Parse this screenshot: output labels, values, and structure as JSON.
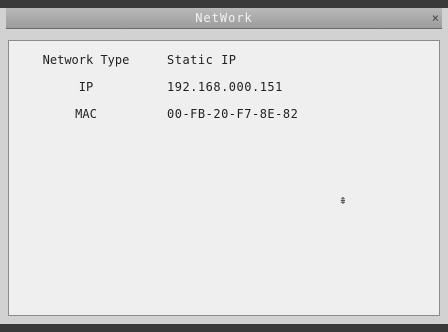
{
  "window": {
    "title": "NetWork",
    "close_glyph": "×"
  },
  "network": {
    "rows": [
      {
        "label": "Network Type",
        "value": "Static IP"
      },
      {
        "label": "IP",
        "value": "192.168.000.151"
      },
      {
        "label": "MAC",
        "value": "00-FB-20-F7-8E-82"
      }
    ]
  },
  "cursor": {
    "glyph": "⇞",
    "icon": "mouse-cursor-icon"
  }
}
